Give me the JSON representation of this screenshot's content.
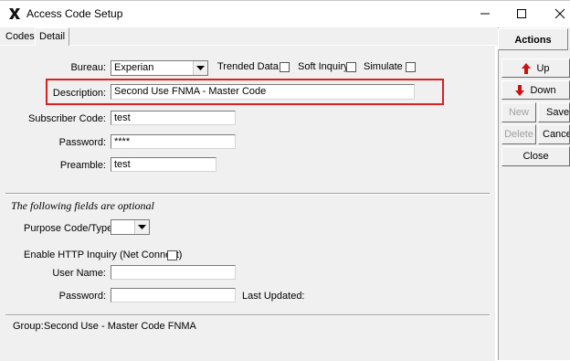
{
  "window": {
    "title": "Access Code Setup",
    "controls": {
      "minimize": "minimize-icon",
      "maximize": "maximize-icon",
      "close": "close-icon"
    }
  },
  "tabs": [
    {
      "label": "Codes"
    },
    {
      "label": "Detail"
    }
  ],
  "form": {
    "bureau_label": "Bureau:",
    "bureau_value": "Experian",
    "trended_label": "Trended Data",
    "soft_inquiry_label": "Soft Inquiry",
    "simulate_label": "Simulate",
    "description_label": "Description:",
    "description_value": "Second Use FNMA - Master Code",
    "subscriber_label": "Subscriber Code:",
    "subscriber_value": "test",
    "password_label": "Password:",
    "password_value": "****",
    "preamble_label": "Preamble:",
    "preamble_value": "test"
  },
  "optional": {
    "title": "The following fields are optional",
    "purpose_label": "Purpose Code/Type:",
    "purpose_value": "",
    "http_label": "Enable HTTP Inquiry (Net Connect)",
    "username_label": "User Name:",
    "username_value": "",
    "password_label": "Password:",
    "password_value": "",
    "last_updated_label": "Last Updated:"
  },
  "group": {
    "label": "Group:",
    "value": "Second Use - Master Code FNMA"
  },
  "actions": {
    "title": "Actions",
    "up": "Up",
    "down": "Down",
    "new": "New",
    "save": "Save",
    "delete": "Delete",
    "cancel": "Cancel",
    "close": "Close"
  },
  "colors": {
    "arrow_red": "#d01010",
    "highlight_red": "#e02020"
  }
}
